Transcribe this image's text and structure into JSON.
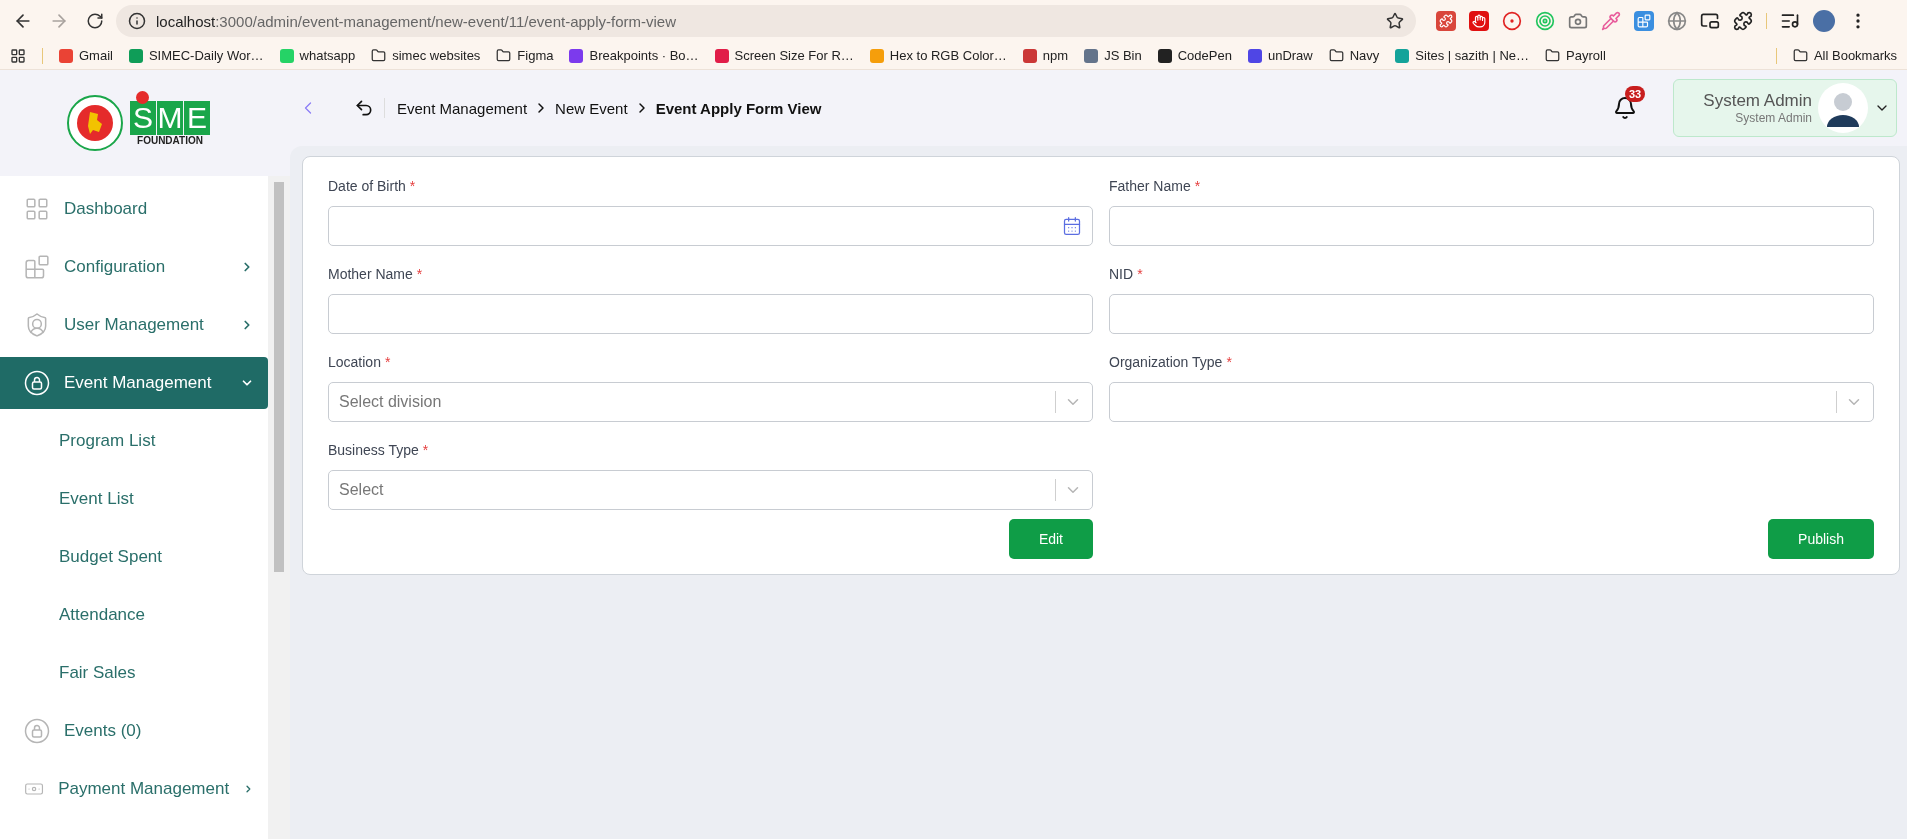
{
  "browser": {
    "url_host": "localhost",
    "url_path": ":3000/admin/event-management/new-event/11/event-apply-form-view",
    "forward_disabled": true,
    "bookmarks": [
      {
        "label": "Gmail",
        "kind": "site",
        "color": "#ea4335"
      },
      {
        "label": "SIMEC-Daily Wor…",
        "kind": "site",
        "color": "#0f9d58"
      },
      {
        "label": "whatsapp",
        "kind": "site",
        "color": "#25d366"
      },
      {
        "label": "simec websites",
        "kind": "folder"
      },
      {
        "label": "Figma",
        "kind": "folder"
      },
      {
        "label": "Breakpoints · Bo…",
        "kind": "site",
        "color": "#7c3aed"
      },
      {
        "label": "Screen Size For R…",
        "kind": "site",
        "color": "#e11d48"
      },
      {
        "label": "Hex to RGB Color…",
        "kind": "site",
        "color": "#f59e0b"
      },
      {
        "label": "npm",
        "kind": "site",
        "color": "#cb3837"
      },
      {
        "label": "JS Bin",
        "kind": "site",
        "color": "#64748b"
      },
      {
        "label": "CodePen",
        "kind": "site",
        "color": "#222222"
      },
      {
        "label": "unDraw",
        "kind": "site",
        "color": "#4f46e5"
      },
      {
        "label": "Navy",
        "kind": "folder"
      },
      {
        "label": "Sites | sazith | Ne…",
        "kind": "site",
        "color": "#14a39a"
      },
      {
        "label": "Payroll",
        "kind": "folder"
      }
    ],
    "all_bookmarks": "All Bookmarks"
  },
  "logo": {
    "letters": [
      "S",
      "M",
      "E"
    ],
    "subtitle": "FOUNDATION"
  },
  "sidebar": {
    "items": [
      {
        "label": "Dashboard",
        "selected": false
      },
      {
        "label": "Configuration",
        "selected": false,
        "expanded": false
      },
      {
        "label": "User Management",
        "selected": false,
        "expanded": false
      },
      {
        "label": "Event Management",
        "selected": true,
        "expanded": true,
        "children": [
          {
            "label": "Program List",
            "selected": false
          },
          {
            "label": "Event List",
            "selected": false
          },
          {
            "label": "Budget Spent",
            "selected": false
          },
          {
            "label": "Attendance",
            "selected": false
          },
          {
            "label": "Fair Sales",
            "selected": false
          }
        ]
      },
      {
        "label": "Events (0)",
        "selected": false
      },
      {
        "label": "Payment Management",
        "selected": false,
        "expanded": false
      }
    ]
  },
  "header": {
    "breadcrumb": [
      {
        "label": "Event Management",
        "current": false
      },
      {
        "label": "New Event",
        "current": false
      },
      {
        "label": "Event Apply Form View",
        "current": true
      }
    ],
    "notification_count": "33",
    "user_name": "System Admin",
    "user_role": "System Admin"
  },
  "form": {
    "fields": [
      {
        "label": "Date of Birth",
        "required_mark": "*",
        "kind": "date"
      },
      {
        "label": "Father Name",
        "required_mark": "*",
        "kind": "text"
      },
      {
        "label": "Mother Name",
        "required_mark": "*",
        "kind": "text"
      },
      {
        "label": "NID",
        "required_mark": "*",
        "kind": "text"
      },
      {
        "label": "Location",
        "required_mark": "*",
        "kind": "select",
        "placeholder": "Select division"
      },
      {
        "label": "Organization Type",
        "required_mark": "*",
        "kind": "select"
      },
      {
        "label": "Business Type",
        "required_mark": "*",
        "kind": "select",
        "placeholder": "Select"
      }
    ],
    "buttons": [
      {
        "label": "Edit"
      },
      {
        "label": "Publish"
      }
    ]
  }
}
